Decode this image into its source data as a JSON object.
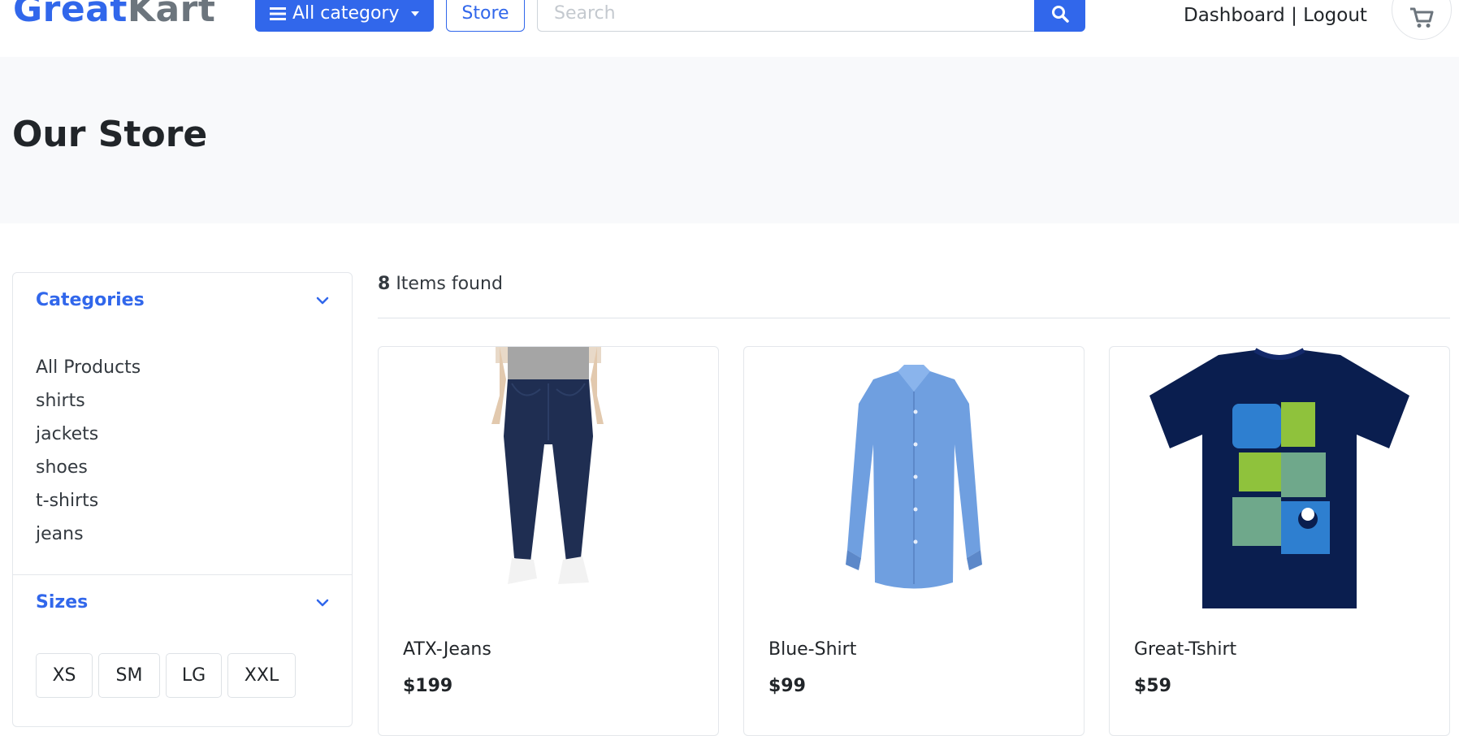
{
  "header": {
    "logo_primary": "Great",
    "logo_secondary": "Kart",
    "category_button_label": "All category",
    "store_button_label": "Store",
    "search_placeholder": "Search",
    "dashboard_link": "Dashboard",
    "separator": "|",
    "logout_link": "Logout",
    "icons": {
      "category": "menu-bars-icon",
      "caret": "caret-down-icon",
      "search": "search-icon",
      "cart": "cart-icon"
    }
  },
  "page": {
    "title": "Our Store"
  },
  "sidebar": {
    "categories_heading": "Categories",
    "categories": [
      "All Products",
      "shirts",
      "jackets",
      "shoes",
      "t-shirts",
      "jeans"
    ],
    "sizes_heading": "Sizes",
    "sizes": [
      "XS",
      "SM",
      "LG",
      "XXL"
    ]
  },
  "results": {
    "count": "8",
    "count_suffix": "Items found"
  },
  "products": [
    {
      "name": "ATX-Jeans",
      "price": "$199",
      "image": "jeans-photo"
    },
    {
      "name": "Blue-Shirt",
      "price": "$99",
      "image": "blue-shirt-photo"
    },
    {
      "name": "Great-Tshirt",
      "price": "$59",
      "image": "graphic-tshirt-photo"
    }
  ],
  "colors": {
    "accent": "#3167eb",
    "band": "#f8f9fb",
    "logo_gray": "#6c757d",
    "top_stripe": "#0f4c81"
  }
}
